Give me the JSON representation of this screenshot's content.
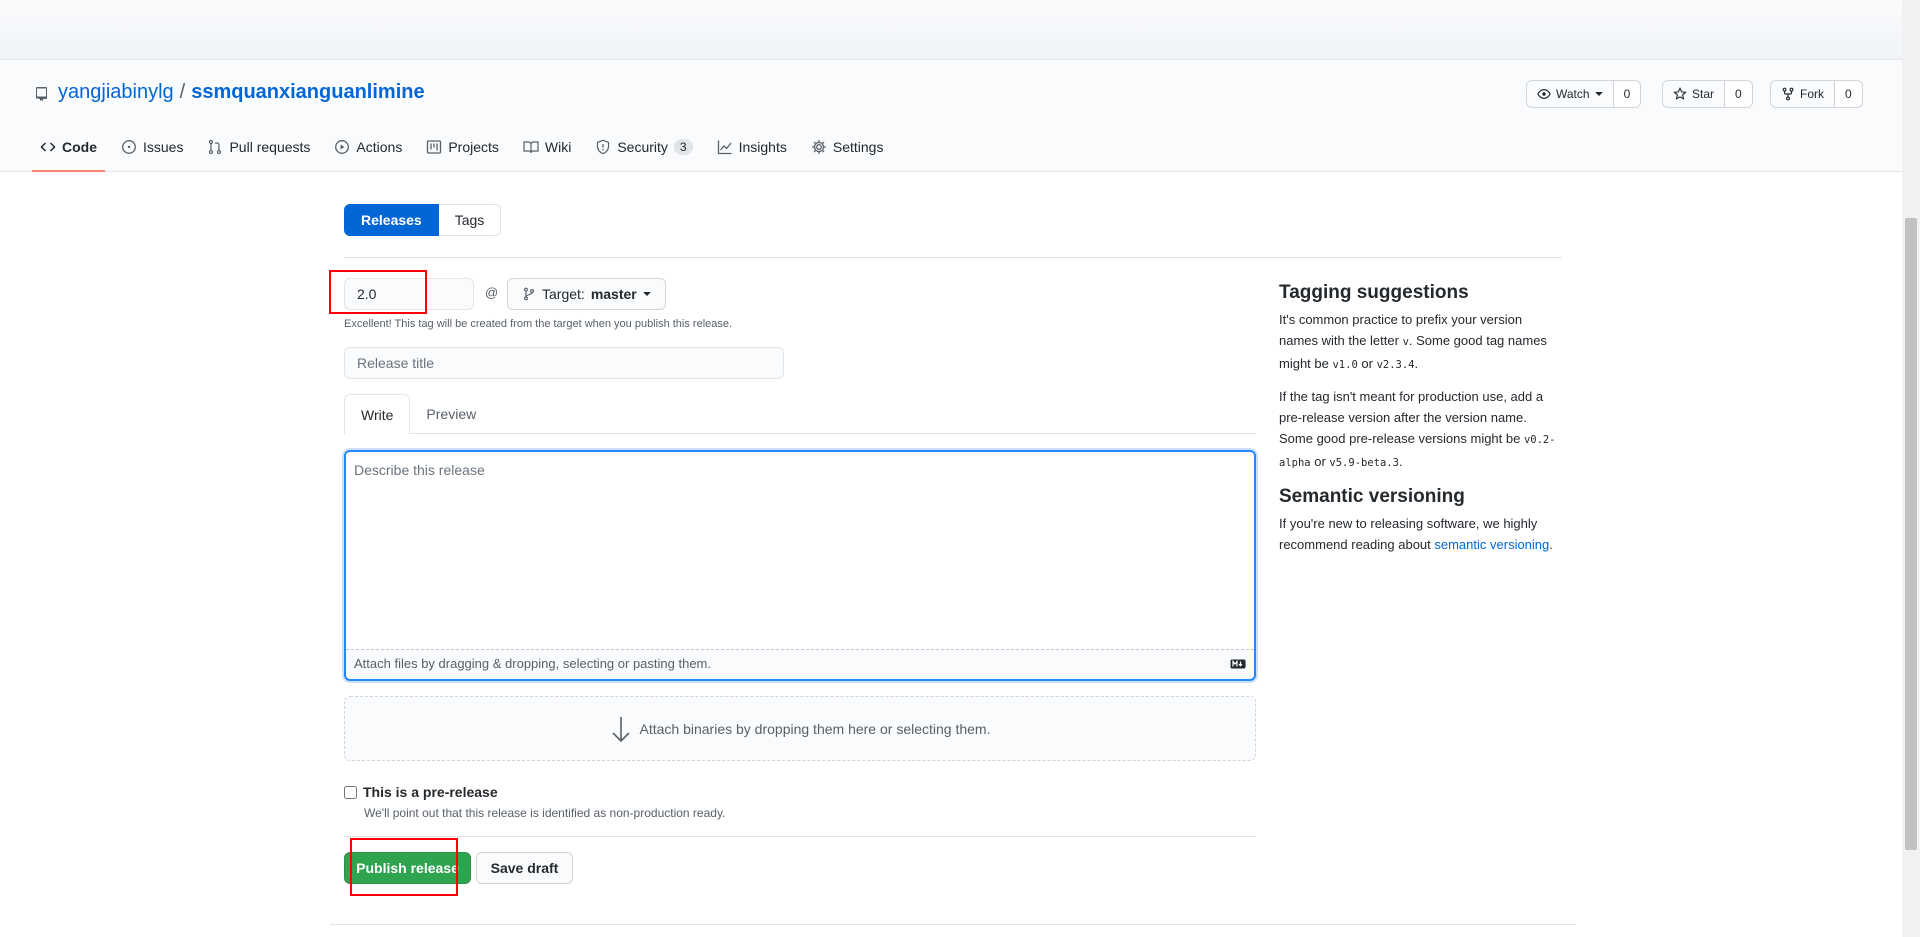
{
  "repo": {
    "owner": "yangjiabinylg",
    "separator": "/",
    "name": "ssmquanxianguanlimine"
  },
  "repo_actions": [
    {
      "label": "Watch",
      "count": "0",
      "icon": "eye-icon"
    },
    {
      "label": "Star",
      "count": "0",
      "icon": "star-icon"
    },
    {
      "label": "Fork",
      "count": "0",
      "icon": "fork-icon"
    }
  ],
  "tabs": [
    {
      "label": "Code",
      "icon": "code-icon",
      "active": true
    },
    {
      "label": "Issues",
      "icon": "issue-icon"
    },
    {
      "label": "Pull requests",
      "icon": "pull-request-icon"
    },
    {
      "label": "Actions",
      "icon": "play-icon"
    },
    {
      "label": "Projects",
      "icon": "project-icon"
    },
    {
      "label": "Wiki",
      "icon": "book-icon"
    },
    {
      "label": "Security",
      "icon": "shield-icon",
      "counter": "3"
    },
    {
      "label": "Insights",
      "icon": "graph-icon"
    },
    {
      "label": "Settings",
      "icon": "gear-icon"
    }
  ],
  "subnav": {
    "releases": "Releases",
    "tags": "Tags"
  },
  "form": {
    "tag_value": "2.0",
    "at": "@",
    "target_prefix": "Target:",
    "target_branch": "master",
    "tag_note": "Excellent! This tag will be created from the target when you publish this release.",
    "title_placeholder": "Release title",
    "write_tab": "Write",
    "preview_tab": "Preview",
    "description_placeholder": "Describe this release",
    "attach_text": "Attach files by dragging & dropping, selecting or pasting them.",
    "binaries_text": "Attach binaries by dropping them here or selecting them.",
    "prerelease_label": "This is a pre-release",
    "prerelease_note": "We'll point out that this release is identified as non-production ready.",
    "publish_label": "Publish release",
    "save_draft_label": "Save draft"
  },
  "sidebar": {
    "tagging_heading": "Tagging suggestions",
    "tagging_p1_a": "It's common practice to prefix your version names with the letter ",
    "tagging_p1_code1": "v",
    "tagging_p1_b": ". Some good tag names might be ",
    "tagging_p1_code2": "v1.0",
    "tagging_p1_c": " or ",
    "tagging_p1_code3": "v2.3.4",
    "tagging_p1_d": ".",
    "tagging_p2_a": "If the tag isn't meant for production use, add a pre-release version after the version name. Some good pre-release versions might be ",
    "tagging_p2_code1": "v0.2-alpha",
    "tagging_p2_b": " or ",
    "tagging_p2_code2": "v5.9-beta.3",
    "tagging_p2_c": ".",
    "semver_heading": "Semantic versioning",
    "semver_text": "If you're new to releasing software, we highly recommend reading about ",
    "semver_link": "semantic versioning",
    "semver_end": "."
  },
  "colors": {
    "accent": "#0366d6",
    "publish": "#2ea44f",
    "active_tab_underline": "#f9826c",
    "annotation_box": "#ff0000"
  }
}
